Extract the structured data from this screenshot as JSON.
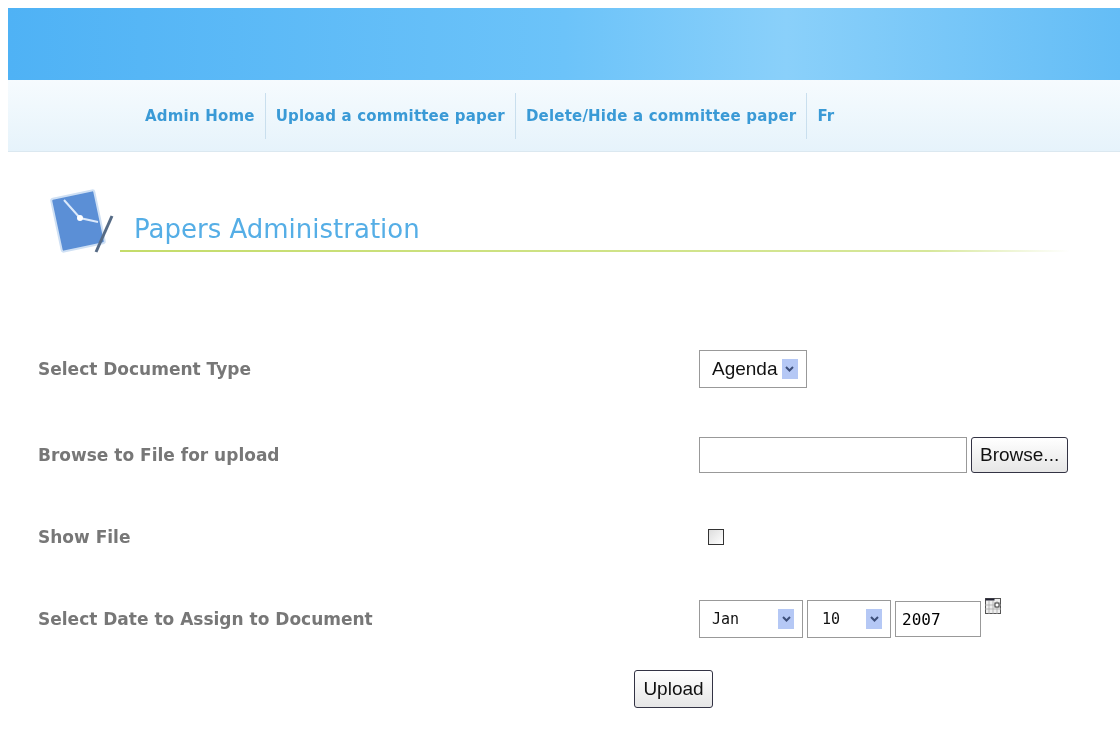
{
  "nav": [
    {
      "label": "Admin Home"
    },
    {
      "label": "Upload a committee paper"
    },
    {
      "label": "Delete/Hide a committee paper"
    },
    {
      "label": "Fr"
    }
  ],
  "heading": "Papers Administration",
  "form": [
    {
      "kind": "select",
      "label": "Select Document Type",
      "value": "Agenda"
    },
    {
      "kind": "file",
      "label": "Browse to File for upload",
      "button": "Browse..."
    },
    {
      "kind": "checkbox",
      "label": "Show File",
      "checked": false
    },
    {
      "kind": "date",
      "label": "Select Date to Assign to Document",
      "month": "Jan",
      "day": "10",
      "year": "2007"
    }
  ],
  "submit": "Upload"
}
